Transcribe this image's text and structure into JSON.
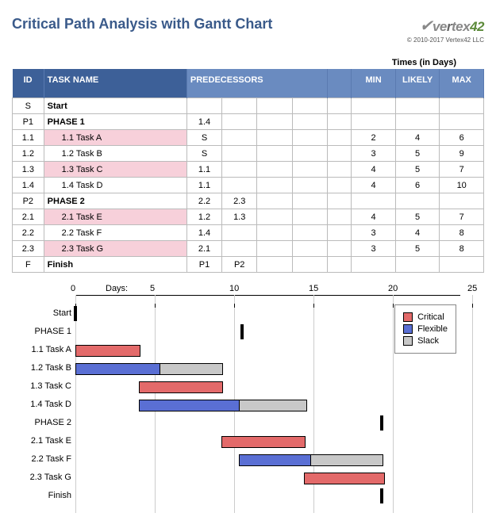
{
  "header": {
    "title": "Critical Path Analysis with Gantt Chart",
    "copyright": "© 2010-2017 Vertex42 LLC"
  },
  "table": {
    "times_header": "Times (in Days)",
    "columns": {
      "id": "ID",
      "task": "TASK NAME",
      "predecessors": "PREDECESSORS",
      "min": "MIN",
      "likely": "LIKELY",
      "max": "MAX"
    },
    "rows": [
      {
        "id": "S",
        "name": "Start",
        "pred": [
          "",
          "",
          "",
          ""
        ],
        "min": "",
        "likely": "",
        "max": "",
        "bold": true,
        "critical": false,
        "indent": 0
      },
      {
        "id": "P1",
        "name": "PHASE 1",
        "pred": [
          "1.4",
          "",
          "",
          ""
        ],
        "min": "",
        "likely": "",
        "max": "",
        "bold": true,
        "critical": false,
        "indent": 0
      },
      {
        "id": "1.1",
        "name": "1.1 Task A",
        "pred": [
          "S",
          "",
          "",
          ""
        ],
        "min": "2",
        "likely": "4",
        "max": "6",
        "bold": false,
        "critical": true,
        "indent": 1
      },
      {
        "id": "1.2",
        "name": "1.2 Task B",
        "pred": [
          "S",
          "",
          "",
          ""
        ],
        "min": "3",
        "likely": "5",
        "max": "9",
        "bold": false,
        "critical": false,
        "indent": 1
      },
      {
        "id": "1.3",
        "name": "1.3 Task C",
        "pred": [
          "1.1",
          "",
          "",
          ""
        ],
        "min": "4",
        "likely": "5",
        "max": "7",
        "bold": false,
        "critical": true,
        "indent": 1
      },
      {
        "id": "1.4",
        "name": "1.4 Task D",
        "pred": [
          "1.1",
          "",
          "",
          ""
        ],
        "min": "4",
        "likely": "6",
        "max": "10",
        "bold": false,
        "critical": false,
        "indent": 1
      },
      {
        "id": "P2",
        "name": "PHASE 2",
        "pred": [
          "2.2",
          "2.3",
          "",
          ""
        ],
        "min": "",
        "likely": "",
        "max": "",
        "bold": true,
        "critical": false,
        "indent": 0
      },
      {
        "id": "2.1",
        "name": "2.1 Task E",
        "pred": [
          "1.2",
          "1.3",
          "",
          ""
        ],
        "min": "4",
        "likely": "5",
        "max": "7",
        "bold": false,
        "critical": true,
        "indent": 1
      },
      {
        "id": "2.2",
        "name": "2.2 Task F",
        "pred": [
          "1.4",
          "",
          "",
          ""
        ],
        "min": "3",
        "likely": "4",
        "max": "8",
        "bold": false,
        "critical": false,
        "indent": 1
      },
      {
        "id": "2.3",
        "name": "2.3 Task G",
        "pred": [
          "2.1",
          "",
          "",
          ""
        ],
        "min": "3",
        "likely": "5",
        "max": "8",
        "bold": false,
        "critical": true,
        "indent": 1
      },
      {
        "id": "F",
        "name": "Finish",
        "pred": [
          "P1",
          "P2",
          "",
          ""
        ],
        "min": "",
        "likely": "",
        "max": "",
        "bold": true,
        "critical": false,
        "indent": 0
      }
    ]
  },
  "chart_data": {
    "type": "gantt",
    "xlabel": "Days:",
    "x_ticks": [
      0,
      5,
      10,
      15,
      20,
      25
    ],
    "xlim": [
      0,
      25
    ],
    "legend": [
      "Critical",
      "Flexible",
      "Slack"
    ],
    "rows": [
      {
        "label": "Start",
        "bars": [],
        "marker": 0
      },
      {
        "label": "PHASE 1",
        "bars": [],
        "marker": 10.5
      },
      {
        "label": "1.1 Task A",
        "bars": [
          {
            "start": 0,
            "dur": 4,
            "type": "crit"
          }
        ],
        "marker": null
      },
      {
        "label": "1.2 Task B",
        "bars": [
          {
            "start": 0,
            "dur": 5.3,
            "type": "flex"
          },
          {
            "start": 5.3,
            "dur": 3.9,
            "type": "slack"
          }
        ],
        "marker": null
      },
      {
        "label": "1.3 Task C",
        "bars": [
          {
            "start": 4,
            "dur": 5.2,
            "type": "crit"
          }
        ],
        "marker": null
      },
      {
        "label": "1.4 Task D",
        "bars": [
          {
            "start": 4,
            "dur": 6.3,
            "type": "flex"
          },
          {
            "start": 10.3,
            "dur": 4.2,
            "type": "slack"
          }
        ],
        "marker": null
      },
      {
        "label": "PHASE 2",
        "bars": [],
        "marker": 19.3
      },
      {
        "label": "2.1 Task E",
        "bars": [
          {
            "start": 9.2,
            "dur": 5.2,
            "type": "crit"
          }
        ],
        "marker": null
      },
      {
        "label": "2.2 Task F",
        "bars": [
          {
            "start": 10.3,
            "dur": 4.5,
            "type": "flex"
          },
          {
            "start": 14.8,
            "dur": 4.5,
            "type": "slack"
          }
        ],
        "marker": null
      },
      {
        "label": "2.3 Task G",
        "bars": [
          {
            "start": 14.4,
            "dur": 5,
            "type": "crit"
          }
        ],
        "marker": null
      },
      {
        "label": "Finish",
        "bars": [],
        "marker": 19.3
      }
    ]
  }
}
